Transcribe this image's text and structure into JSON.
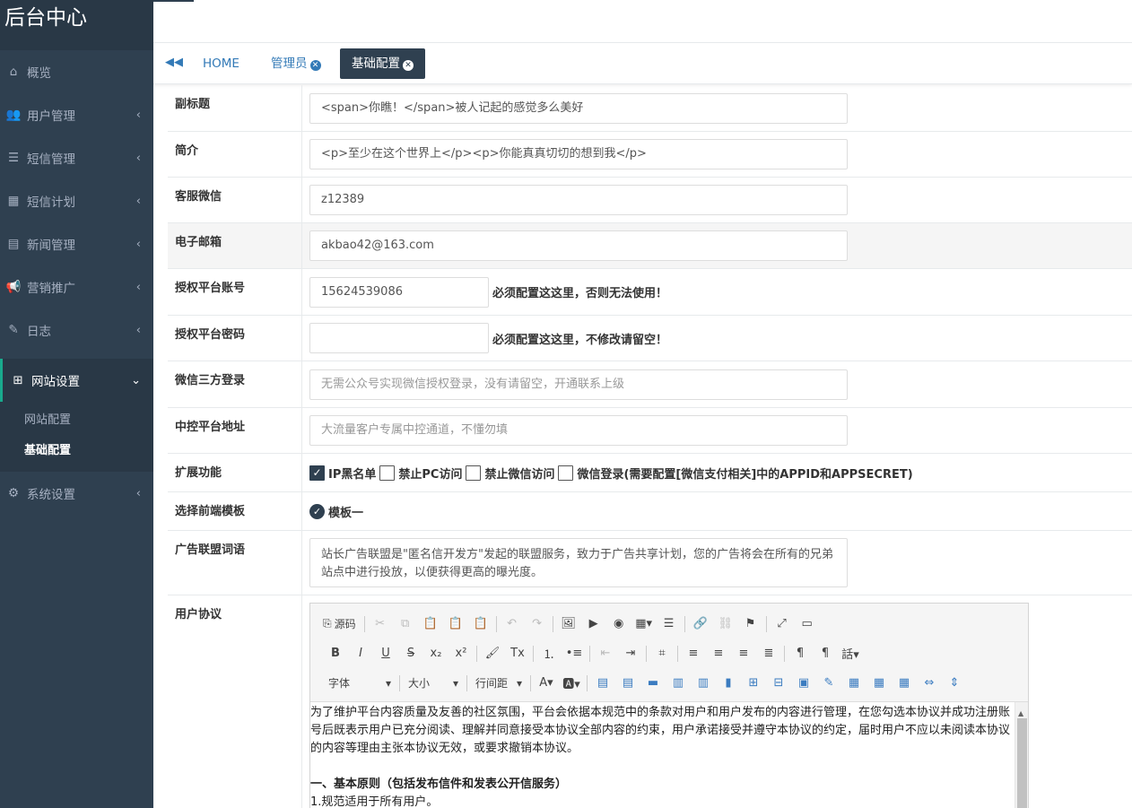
{
  "brand": "后台中心",
  "nav": [
    {
      "label": "概览",
      "icon": "home-icon",
      "glyph": "⌂",
      "arrow": ""
    },
    {
      "label": "用户管理",
      "icon": "users-icon",
      "glyph": "👥",
      "arrow": "‹"
    },
    {
      "label": "短信管理",
      "icon": "list-icon",
      "glyph": "☰",
      "arrow": "‹"
    },
    {
      "label": "短信计划",
      "icon": "calendar-icon",
      "glyph": "▦",
      "arrow": "‹"
    },
    {
      "label": "新闻管理",
      "icon": "newspaper-icon",
      "glyph": "▤",
      "arrow": "‹"
    },
    {
      "label": "营销推广",
      "icon": "bullhorn-icon",
      "glyph": "📢",
      "arrow": "‹"
    },
    {
      "label": "日志",
      "icon": "edit-icon",
      "glyph": "✎",
      "arrow": "‹"
    }
  ],
  "nav_active": {
    "label": "网站设置",
    "icon": "sitemap-icon",
    "glyph": "⊞",
    "arrow": "⌄"
  },
  "subnav": [
    "网站配置",
    "基础配置"
  ],
  "nav_bottom": {
    "label": "系统设置",
    "icon": "gear-icon",
    "glyph": "⚙",
    "arrow": "‹"
  },
  "tabs": {
    "back_glyph": "◀◀",
    "home": "HOME",
    "admin": "管理员",
    "basic": "基础配置",
    "close_glyph": "✕"
  },
  "form": {
    "subtitle": {
      "label": "副标题",
      "value": "<span>你瞧！</span>被人记起的感觉多么美好"
    },
    "intro": {
      "label": "简介",
      "value": "<p>至少在这个世界上</p><p>你能真真切切的想到我</p>"
    },
    "wechat_service": {
      "label": "客服微信",
      "value": "z12389"
    },
    "email": {
      "label": "电子邮箱",
      "value": "akbao42@163.com"
    },
    "auth_account": {
      "label": "授权平台账号",
      "value": "15624539086",
      "note": "必须配置这这里，否则无法使用！"
    },
    "auth_password": {
      "label": "授权平台密码",
      "value": "",
      "note": "必须配置这这里，不修改请留空！"
    },
    "wechat_login": {
      "label": "微信三方登录",
      "placeholder": "无需公众号实现微信授权登录，没有请留空，开通联系上级"
    },
    "control_addr": {
      "label": "中控平台地址",
      "placeholder": "大流量客户专属中控通道，不懂勿填"
    },
    "extensions": {
      "label": "扩展功能",
      "options": [
        {
          "text": "IP黑名单",
          "checked": true
        },
        {
          "text": "禁止PC访问",
          "checked": false
        },
        {
          "text": "禁止微信访问",
          "checked": false
        },
        {
          "text": "微信登录(需要配置[微信支付相关]中的APPID和APPSECRET)",
          "checked": false
        }
      ]
    },
    "template": {
      "label": "选择前端模板",
      "option": "模板一",
      "check_glyph": "✓"
    },
    "ad_slogan": {
      "label": "广告联盟词语",
      "value": "站长广告联盟是\"匿名信开发方\"发起的联盟服务，致力于广告共享计划，您的广告将会在所有的兄弟站点中进行投放，以便获得更高的曝光度。"
    },
    "agreement": {
      "label": "用户协议"
    }
  },
  "editor": {
    "source_label": "源码",
    "font_select": "字体",
    "size_select": "大小",
    "line_height_select": "行间距",
    "check_glyph": "✓",
    "row1": [
      {
        "name": "cut-icon",
        "glyph": "✂",
        "dim": true
      },
      {
        "name": "copy-icon",
        "glyph": "⧉",
        "dim": true
      },
      {
        "name": "paste-icon",
        "glyph": "📋",
        "dim": false
      },
      {
        "name": "paste-text-icon",
        "glyph": "📋",
        "dim": false
      },
      {
        "name": "paste-word-icon",
        "glyph": "📋",
        "dim": false
      },
      {
        "sep": true
      },
      {
        "name": "undo-icon",
        "glyph": "↶",
        "dim": true
      },
      {
        "name": "redo-icon",
        "glyph": "↷",
        "dim": true
      },
      {
        "sep": true
      },
      {
        "name": "image-icon",
        "glyph": "🖼",
        "dim": false
      },
      {
        "name": "video-icon",
        "glyph": "▶",
        "dim": false
      },
      {
        "name": "flash-icon",
        "glyph": "◉",
        "dim": false
      },
      {
        "name": "table-icon",
        "glyph": "▦▾",
        "dim": false
      },
      {
        "name": "hr-icon",
        "glyph": "☰",
        "dim": false
      },
      {
        "sep": true
      },
      {
        "name": "link-icon",
        "glyph": "🔗",
        "dim": false
      },
      {
        "name": "unlink-icon",
        "glyph": "⛓",
        "dim": true
      },
      {
        "name": "anchor-icon",
        "glyph": "⚑",
        "dim": false
      },
      {
        "sep": true
      },
      {
        "name": "maximize-icon",
        "glyph": "⤢",
        "dim": false
      },
      {
        "name": "preview-icon",
        "glyph": "▭",
        "dim": false
      }
    ],
    "row2": [
      {
        "name": "bold-icon",
        "glyph": "B",
        "dim": false
      },
      {
        "name": "italic-icon",
        "glyph": "I",
        "dim": false
      },
      {
        "name": "underline-icon",
        "glyph": "U",
        "dim": false
      },
      {
        "name": "strikethrough-icon",
        "glyph": "S",
        "dim": false
      },
      {
        "name": "subscript-icon",
        "glyph": "x₂",
        "dim": false
      },
      {
        "name": "superscript-icon",
        "glyph": "x²",
        "dim": false
      },
      {
        "sep": true
      },
      {
        "name": "format-painter-icon",
        "glyph": "🖌",
        "dim": false
      },
      {
        "name": "clear-format-icon",
        "glyph": "Tx",
        "dim": false
      },
      {
        "sep": true
      },
      {
        "name": "ordered-list-icon",
        "glyph": "⒈",
        "dim": false
      },
      {
        "name": "unordered-list-icon",
        "glyph": "•≡",
        "dim": false
      },
      {
        "sep": true
      },
      {
        "name": "outdent-icon",
        "glyph": "⇤",
        "dim": true
      },
      {
        "name": "indent-icon",
        "glyph": "⇥",
        "dim": false
      },
      {
        "sep": true
      },
      {
        "name": "div-icon",
        "glyph": "⌗",
        "dim": false
      },
      {
        "sep": true
      },
      {
        "name": "align-left-icon",
        "glyph": "≡",
        "dim": false
      },
      {
        "name": "align-center-icon",
        "glyph": "≡",
        "dim": false
      },
      {
        "name": "align-right-icon",
        "glyph": "≡",
        "dim": false
      },
      {
        "name": "align-justify-icon",
        "glyph": "≣",
        "dim": false
      },
      {
        "sep": true
      },
      {
        "name": "ltr-icon",
        "glyph": "¶",
        "dim": false
      },
      {
        "name": "rtl-icon",
        "glyph": "¶",
        "dim": false
      },
      {
        "name": "language-icon",
        "glyph": "話▾",
        "dim": false
      }
    ],
    "row3_icons": [
      {
        "name": "table-insert-row-before-icon",
        "glyph": "▤"
      },
      {
        "name": "table-insert-row-after-icon",
        "glyph": "▤"
      },
      {
        "name": "table-delete-row-icon",
        "glyph": "▬"
      },
      {
        "name": "table-insert-col-before-icon",
        "glyph": "▥"
      },
      {
        "name": "table-insert-col-after-icon",
        "glyph": "▥"
      },
      {
        "name": "table-delete-col-icon",
        "glyph": "▮"
      },
      {
        "name": "table-split-cell-icon",
        "glyph": "⊞"
      },
      {
        "name": "table-merge-cell-icon",
        "glyph": "⊟"
      },
      {
        "name": "table-delete-cell-icon",
        "glyph": "▣"
      },
      {
        "name": "table-cell-props-icon",
        "glyph": "✎"
      },
      {
        "name": "table-props-icon",
        "glyph": "▦"
      },
      {
        "name": "table-grid-icon",
        "glyph": "▦"
      },
      {
        "name": "table-grid2-icon",
        "glyph": "▦"
      },
      {
        "name": "table-merge-h-icon",
        "glyph": "⇔"
      },
      {
        "name": "table-merge-v-icon",
        "glyph": "⇕"
      }
    ],
    "body": {
      "p1": "为了维护平台内容质量及友善的社区氛围，平台会依据本规范中的条款对用户和用户发布的内容进行管理，在您勾选本协议并成功注册账号后既表示用户已充分阅读、理解并同意接受本协议全部内容的约束，用户承诺接受并遵守本协议的约定，届时用户不应以未阅读本协议的内容等理由主张本协议无效，或要求撤销本协议。",
      "h1": "一、基本原则（包括发布信件和发表公开信服务）",
      "p2": "1.规范适用于所有用户。"
    }
  },
  "colors": {
    "sidebar_bg": "#2f4050",
    "sidebar_dark": "#293846",
    "accent": "#19aa8d",
    "link": "#337ab7"
  }
}
